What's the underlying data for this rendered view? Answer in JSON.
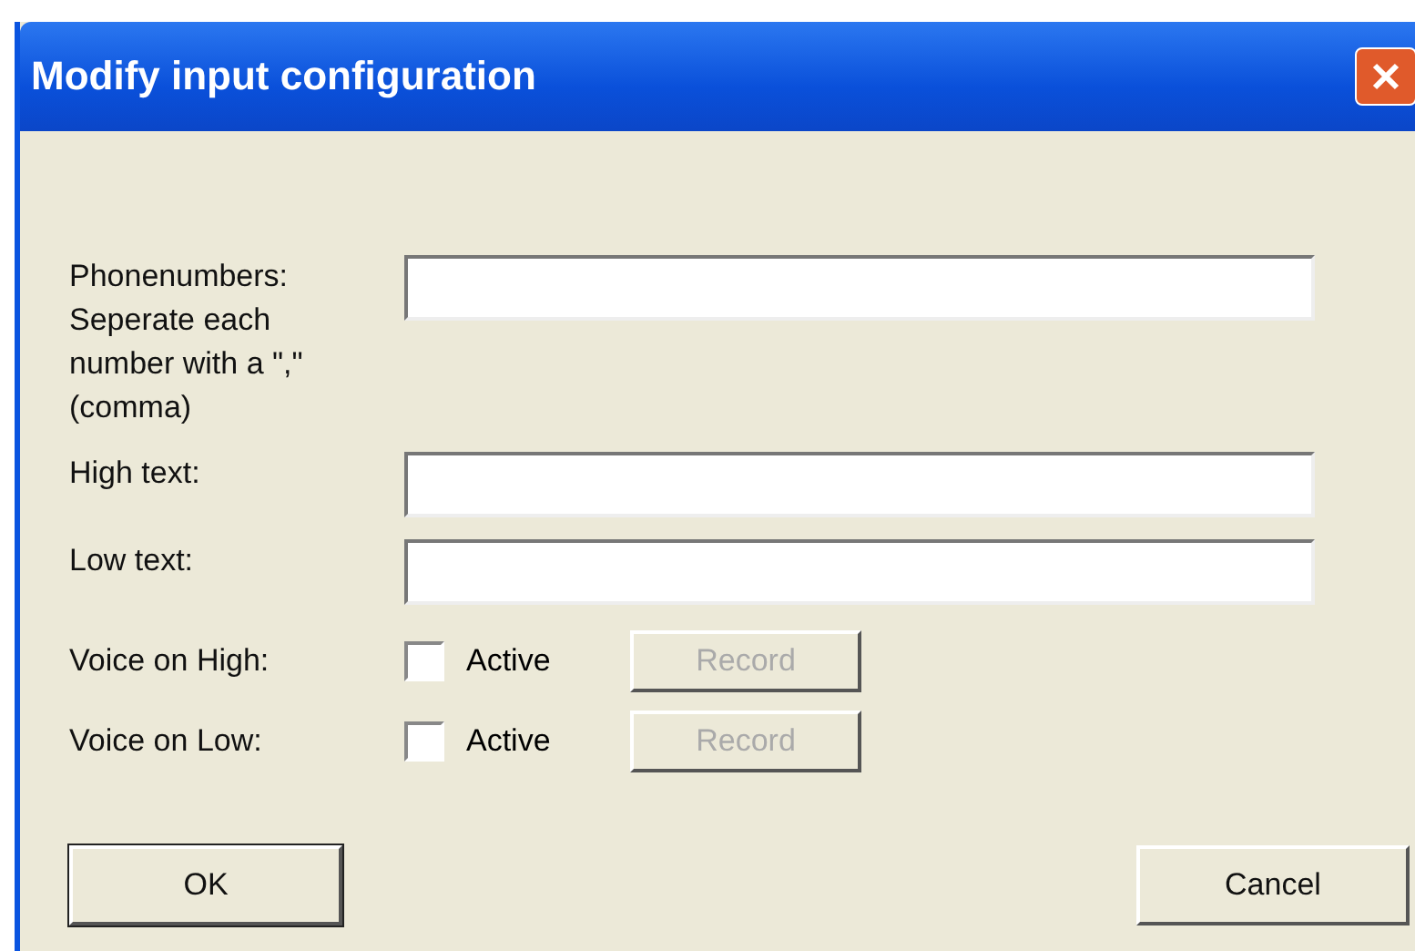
{
  "window": {
    "title": "Modify input configuration"
  },
  "fields": [
    {
      "label": "Phonenumbers:\nSeperate each\nnumber with a \",\"\n(comma)"
    },
    {
      "label": "High text:"
    },
    {
      "label": "Low text:"
    }
  ],
  "voice_rows": [
    {
      "label": "Voice on High:",
      "checkbox": {
        "label": "Active",
        "checked": false
      },
      "button": {
        "label": "Record",
        "disabled": true
      }
    },
    {
      "label": "Voice on Low:",
      "checkbox": {
        "label": "Active",
        "checked": false
      },
      "button": {
        "label": "Record",
        "disabled": true
      }
    }
  ],
  "buttons": [
    {
      "label": "OK",
      "default": true
    },
    {
      "label": "Cancel",
      "default": false
    }
  ]
}
